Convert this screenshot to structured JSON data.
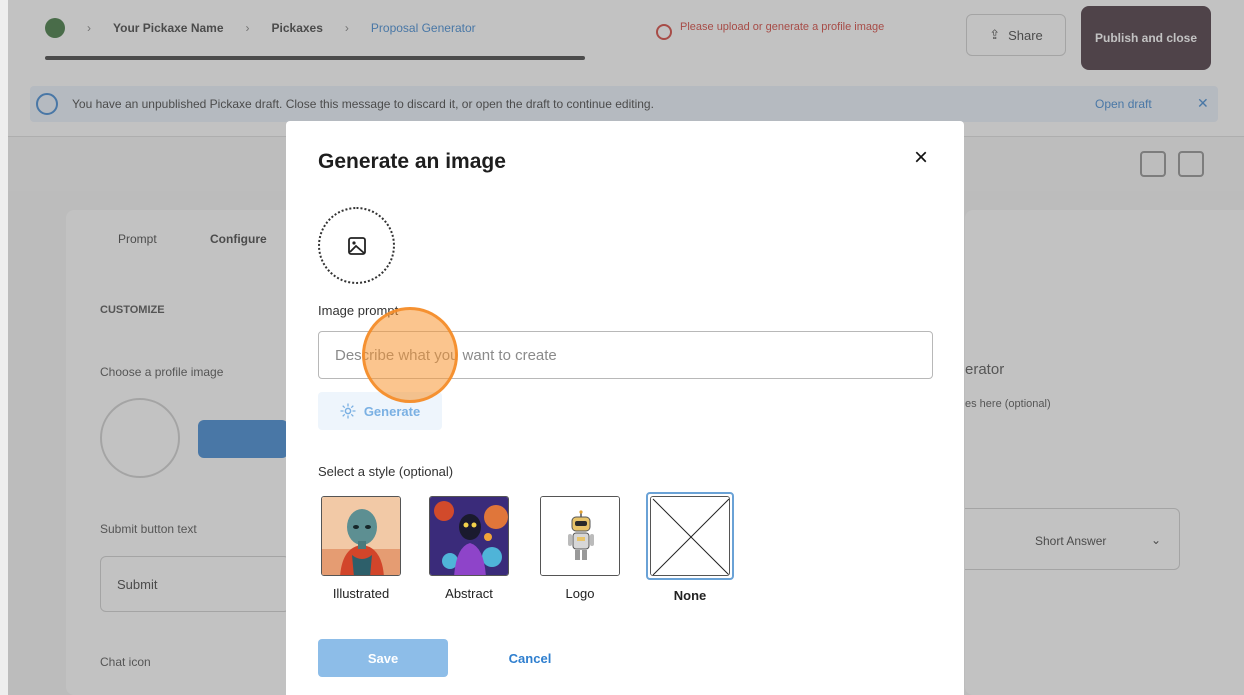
{
  "app": {
    "breadcrumb": [
      "Your Pickaxe Name",
      "Pickaxes",
      "Proposal Generator"
    ],
    "error_text": "Please upload or generate a profile image",
    "share_label": "Share",
    "publish_label": "Publish and close",
    "banner_text": "You have an unpublished Pickaxe draft. Close this message to discard it, or open the draft to continue editing.",
    "banner_open_draft": "Open draft",
    "banner_close": "✕",
    "tabs": [
      "Prompt",
      "Configure"
    ],
    "section_heading": "CUSTOMIZE",
    "profile_image_label": "Choose a profile image",
    "submit_label": "Submit button text",
    "submit_value": "Submit",
    "chat_icon_label": "Chat icon",
    "right_heading": "erator",
    "right_sub": "es here (optional)",
    "right_select": "Short Answer"
  },
  "modal": {
    "title": "Generate an image",
    "close_label": "×",
    "image_prompt_label": "Image prompt",
    "prompt_placeholder": "Describe what you want to create",
    "generate_label": "Generate",
    "style_label": "Select a style (optional)",
    "styles": [
      {
        "name": "Illustrated",
        "selected": false
      },
      {
        "name": "Abstract",
        "selected": false
      },
      {
        "name": "Logo",
        "selected": false
      },
      {
        "name": "None",
        "selected": true
      }
    ],
    "save_label": "Save",
    "cancel_label": "Cancel"
  },
  "colors": {
    "accent": "#2f7fcf",
    "save_disabled": "#8dbde8",
    "error": "#d0342c",
    "publish_bg": "#3a2530"
  }
}
